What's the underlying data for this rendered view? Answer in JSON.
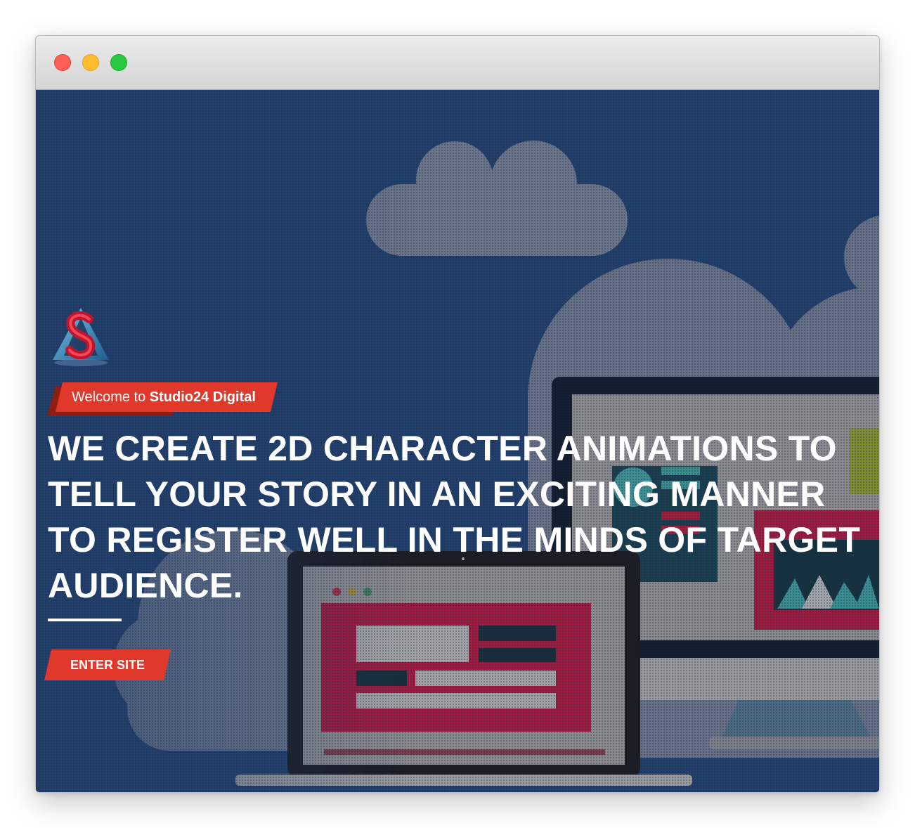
{
  "window": {
    "controls": [
      "close-button",
      "minimize-button",
      "maximize-button"
    ]
  },
  "hero": {
    "logo_icon": "studio24-logo-icon",
    "welcome_prefix": "Welcome to",
    "welcome_brand": "Studio24 Digital",
    "headline": "WE CREATE 2D CHARACTER ANIMATIONS TO TELL YOUR STORY IN AN EXCITING MANNER TO REGISTER WELL IN THE MINDS OF TARGET AUDIENCE.",
    "cta_label": "ENTER SITE"
  },
  "colors": {
    "background": "#22406b",
    "accent": "#e0382a",
    "accent_dark": "#8f1d14",
    "text": "#ffffff"
  }
}
